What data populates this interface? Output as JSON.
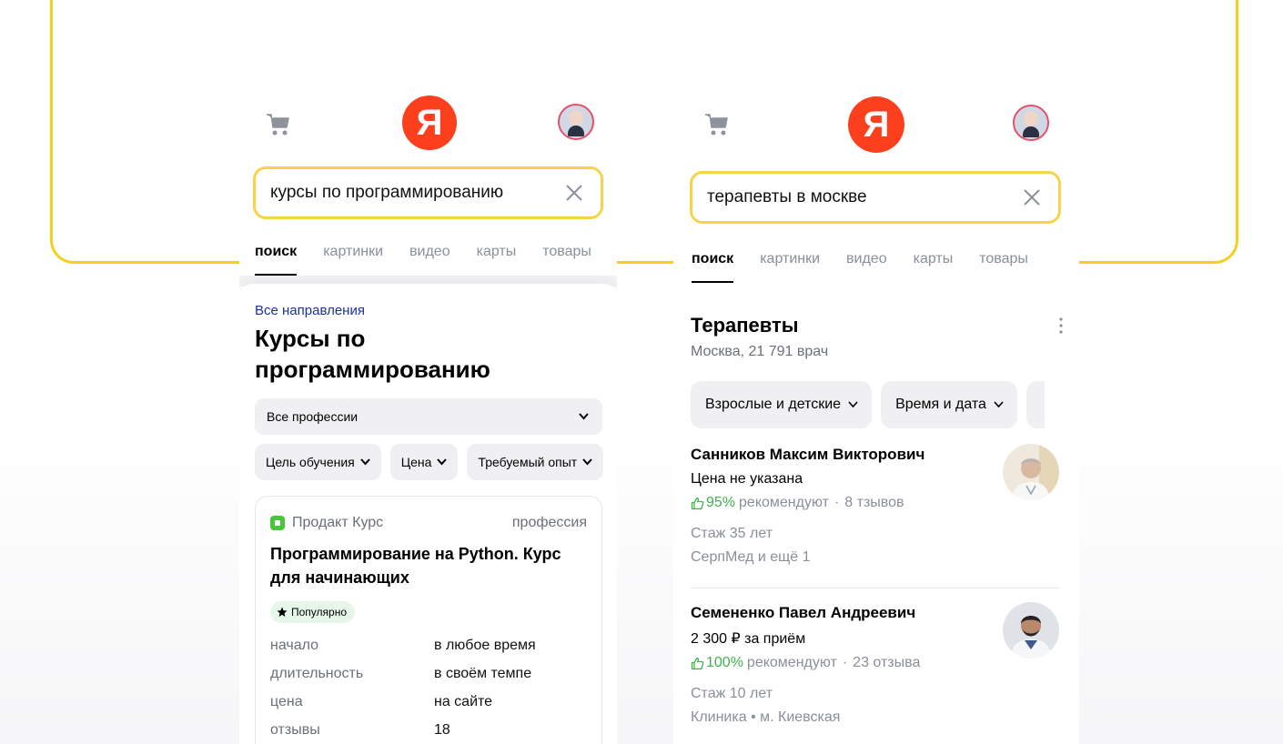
{
  "colors": {
    "accent_yellow": "#f5cf1e",
    "yandex_red": "#fc3f1d",
    "link_blue": "#1b2ea8",
    "rating_green": "#3fb24c"
  },
  "logo": {
    "letter": "Я"
  },
  "phone1": {
    "search": {
      "value": "курсы по программированию"
    },
    "tabs": [
      "поиск",
      "картинки",
      "видео",
      "карты",
      "товары"
    ],
    "breadcrumb": "Все направления",
    "title": "Курсы по программированию",
    "select_label": "Все профессии",
    "chips": [
      "Цель обучения",
      "Цена",
      "Требуемый опыт"
    ],
    "card": {
      "provider": "Продакт Курс",
      "type": "профессия",
      "title": "Программирование на Python. Курс для начинающих",
      "badge": "Популярно",
      "rows": [
        {
          "label": "начало",
          "value": "в любое время"
        },
        {
          "label": "длительность",
          "value": "в своём темпе"
        },
        {
          "label": "цена",
          "value": "на сайте"
        },
        {
          "label": "отзывы",
          "value": "18"
        }
      ]
    }
  },
  "phone2": {
    "search": {
      "value": "терапевты в москве"
    },
    "tabs": [
      "поиск",
      "картинки",
      "видео",
      "карты",
      "товары"
    ],
    "section_title": "Терапевты",
    "section_sub": "Москва, 21 791 врач",
    "chips": [
      "Взрослые и детские",
      "Время и дата"
    ],
    "doctors": [
      {
        "name": "Санников Максим Викторович",
        "price": "Цена не указана",
        "rating": "95%",
        "rating_text": "рекомендуют",
        "reviews": "8 тзывов",
        "experience": "Стаж 35 лет",
        "clinic": "СерпМед и ещё 1"
      },
      {
        "name": "Семененко Павел Андреевич",
        "price": "2 300 ₽ за приём",
        "rating": "100%",
        "rating_text": "рекомендуют",
        "reviews": "23 отзыва",
        "experience": "Стаж 10 лет",
        "clinic": "Клиника  • м. Киевская"
      }
    ]
  }
}
